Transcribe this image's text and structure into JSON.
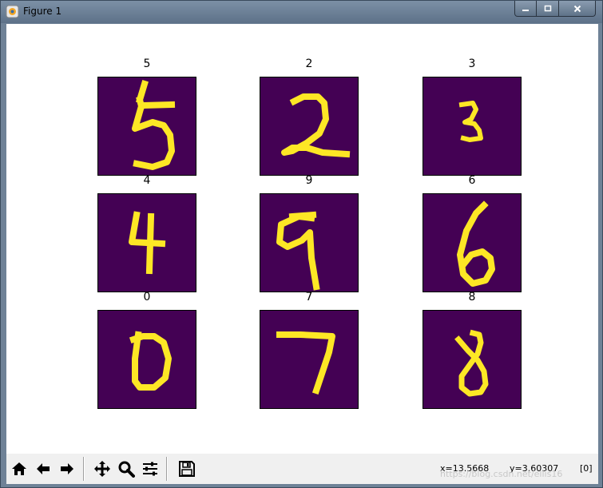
{
  "window": {
    "title": "Figure 1"
  },
  "subplots": [
    {
      "title": "5",
      "digit": "5"
    },
    {
      "title": "2",
      "digit": "2"
    },
    {
      "title": "3",
      "digit": "3"
    },
    {
      "title": "4",
      "digit": "4"
    },
    {
      "title": "9",
      "digit": "9"
    },
    {
      "title": "6",
      "digit": "6"
    },
    {
      "title": "0",
      "digit": "0"
    },
    {
      "title": "7",
      "digit": "7"
    },
    {
      "title": "8",
      "digit": "8"
    }
  ],
  "colors": {
    "background": "#440154",
    "foreground": "#fde725"
  },
  "toolbar": {
    "buttons": [
      "home-icon",
      "back-arrow-icon",
      "forward-arrow-icon",
      "pan-icon",
      "zoom-icon",
      "configure-icon",
      "save-icon"
    ]
  },
  "status": {
    "x": "x=13.5668",
    "y": "y=3.60307",
    "value": "[0]"
  },
  "watermark": "https://blog.csdn.net/ellis16"
}
